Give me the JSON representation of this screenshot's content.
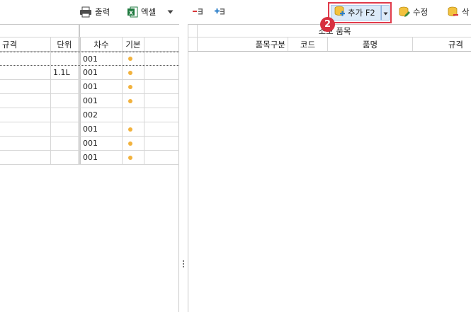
{
  "toolbar": {
    "print_label": "출력",
    "excel_label": "엑셀",
    "add_label": "추가 F2",
    "edit_label": "수정",
    "delete_label": "삭"
  },
  "step_badge": "2",
  "left_grid": {
    "columns": [
      "규격",
      "단위",
      "차수",
      "기본"
    ],
    "rows": [
      {
        "spec": "",
        "unit": "",
        "seq": "001",
        "default": true
      },
      {
        "spec": "",
        "unit": "1.1L",
        "seq": "001",
        "default": true
      },
      {
        "spec": "",
        "unit": "",
        "seq": "001",
        "default": true
      },
      {
        "spec": "",
        "unit": "",
        "seq": "001",
        "default": true
      },
      {
        "spec": "",
        "unit": "",
        "seq": "002",
        "default": false
      },
      {
        "spec": "",
        "unit": "",
        "seq": "001",
        "default": true
      },
      {
        "spec": "",
        "unit": "",
        "seq": "001",
        "default": true
      },
      {
        "spec": "",
        "unit": "",
        "seq": "001",
        "default": true
      }
    ]
  },
  "right_grid": {
    "group_header": "소모 품목",
    "columns": [
      "품목구분",
      "코드",
      "품명",
      "규격"
    ]
  },
  "colors": {
    "highlight_border": "#e03a4a",
    "badge": "#d7303f",
    "default_dot": "#f2b23d",
    "add_button_bg": "#dceaf8"
  }
}
